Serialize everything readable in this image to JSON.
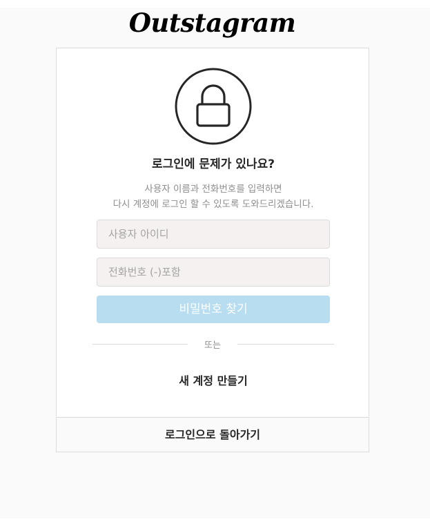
{
  "brand": {
    "logo_text": "Outstagram"
  },
  "help": {
    "lock_icon": "lock-icon",
    "title": "로그인에 문제가 있나요?",
    "description_line1": "사용자 이름과 전화번호를 입력하면",
    "description_line2": "다시 계정에 로그인 할 수 있도록 도와드리겠습니다."
  },
  "form": {
    "username_placeholder": "사용자 아이디",
    "username_value": "",
    "phone_placeholder": "전화번호 (-)포함",
    "phone_value": "",
    "submit_label": "비밀번호 찾기"
  },
  "divider": {
    "label": "또는"
  },
  "links": {
    "create_account": "새 계정 만들기",
    "back_to_login": "로그인으로 돌아가기"
  },
  "colors": {
    "submit_bg": "#b8dcf0",
    "field_bg": "#f5f1f0",
    "border": "#dbdbdb",
    "page_bg": "#fafafa"
  }
}
